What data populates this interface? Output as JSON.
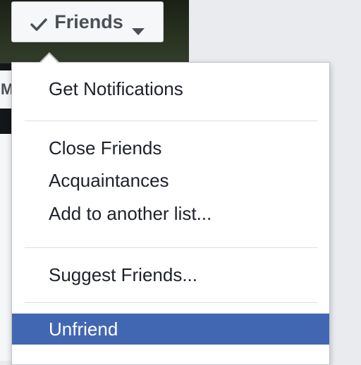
{
  "header": {
    "friends_button": {
      "label": "Friends",
      "icon": "check-icon",
      "dropdown_icon": "caret-down-icon"
    },
    "nav_stub_letter": "M"
  },
  "menu": {
    "sections": [
      {
        "items": [
          {
            "label": "Get Notifications"
          }
        ]
      },
      {
        "items": [
          {
            "label": "Close Friends"
          },
          {
            "label": "Acquaintances"
          },
          {
            "label": "Add to another list..."
          }
        ]
      },
      {
        "items": [
          {
            "label": "Suggest Friends..."
          }
        ]
      },
      {
        "items": [
          {
            "label": "Unfriend",
            "selected": true
          }
        ]
      }
    ],
    "selected_color": "#4267b2"
  }
}
